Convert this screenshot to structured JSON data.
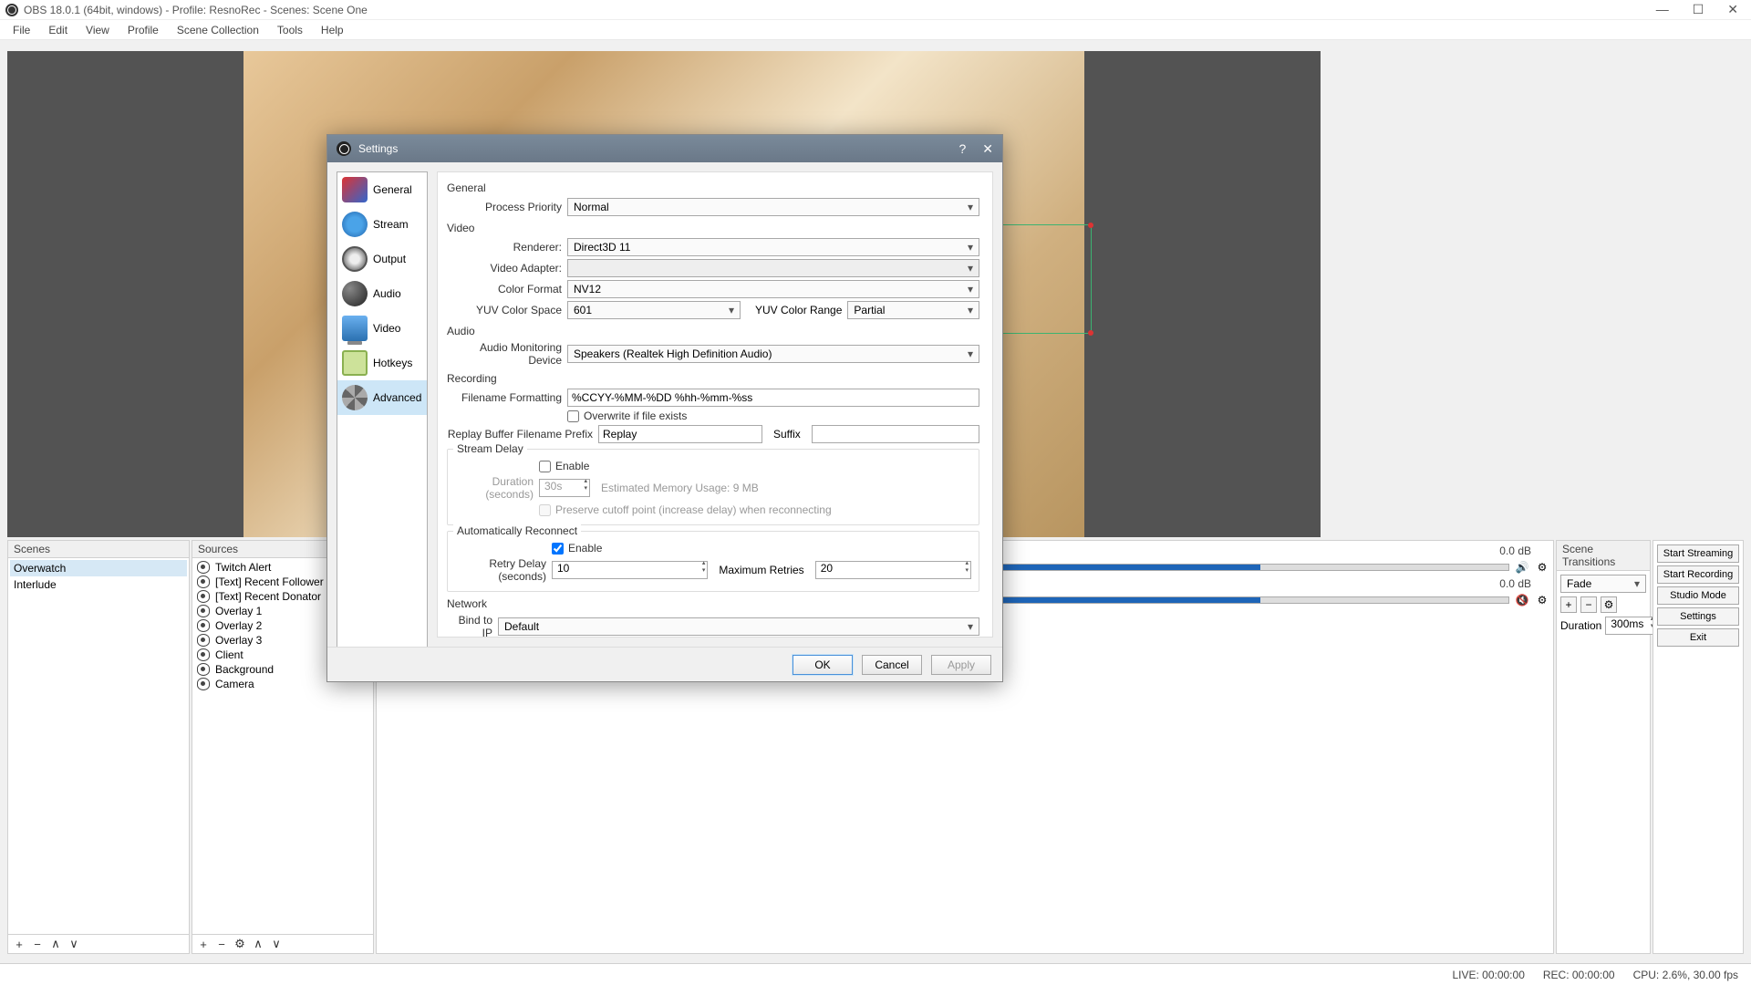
{
  "window": {
    "title": "OBS 18.0.1 (64bit, windows) - Profile: ResnoRec - Scenes: Scene One"
  },
  "menu": [
    "File",
    "Edit",
    "View",
    "Profile",
    "Scene Collection",
    "Tools",
    "Help"
  ],
  "panels": {
    "scenes": {
      "title": "Scenes",
      "items": [
        "Overwatch",
        "Interlude"
      ],
      "selected": 0
    },
    "sources": {
      "title": "Sources",
      "items": [
        "Twitch Alert",
        "[Text] Recent Follower",
        "[Text] Recent Donator",
        "Overlay 1",
        "Overlay 2",
        "Overlay 3",
        "Client",
        "Background",
        "Camera"
      ]
    },
    "transitions": {
      "title": "Scene Transitions",
      "type": "Fade",
      "duration_label": "Duration",
      "duration": "300ms"
    },
    "mixer": {
      "db1": "0.0 dB",
      "db2": "0.0 dB"
    },
    "controls": {
      "buttons": [
        "Start Streaming",
        "Start Recording",
        "Studio Mode",
        "Settings",
        "Exit"
      ]
    }
  },
  "status": {
    "live": "LIVE: 00:00:00",
    "rec": "REC: 00:00:00",
    "cpu": "CPU: 2.6%, 30.00 fps"
  },
  "settings": {
    "title": "Settings",
    "nav": [
      "General",
      "Stream",
      "Output",
      "Audio",
      "Video",
      "Hotkeys",
      "Advanced"
    ],
    "nav_selected": 6,
    "sections": {
      "general": {
        "title": "General",
        "process_priority_label": "Process Priority",
        "process_priority": "Normal"
      },
      "video": {
        "title": "Video",
        "renderer_label": "Renderer:",
        "renderer": "Direct3D 11",
        "video_adapter_label": "Video Adapter:",
        "video_adapter": "",
        "color_format_label": "Color Format",
        "color_format": "NV12",
        "yuv_space_label": "YUV Color Space",
        "yuv_space": "601",
        "yuv_range_label": "YUV Color Range",
        "yuv_range": "Partial"
      },
      "audio": {
        "title": "Audio",
        "monitor_label": "Audio Monitoring Device",
        "monitor": "Speakers (Realtek High Definition Audio)"
      },
      "recording": {
        "title": "Recording",
        "filename_label": "Filename Formatting",
        "filename": "%CCYY-%MM-%DD %hh-%mm-%ss",
        "overwrite": "Overwrite if file exists",
        "prefix_label": "Replay Buffer Filename Prefix",
        "prefix": "Replay",
        "suffix_label": "Suffix",
        "suffix": ""
      },
      "stream_delay": {
        "title": "Stream Delay",
        "enable": "Enable",
        "duration_label": "Duration (seconds)",
        "duration": "30s",
        "memory": "Estimated Memory Usage: 9 MB",
        "preserve": "Preserve cutoff point (increase delay) when reconnecting"
      },
      "reconnect": {
        "title": "Automatically Reconnect",
        "enable": "Enable",
        "retry_label": "Retry Delay (seconds)",
        "retry": "10",
        "max_label": "Maximum Retries",
        "max": "20"
      },
      "network": {
        "title": "Network",
        "bind_label": "Bind to IP",
        "bind": "Default"
      }
    },
    "buttons": {
      "ok": "OK",
      "cancel": "Cancel",
      "apply": "Apply"
    }
  }
}
